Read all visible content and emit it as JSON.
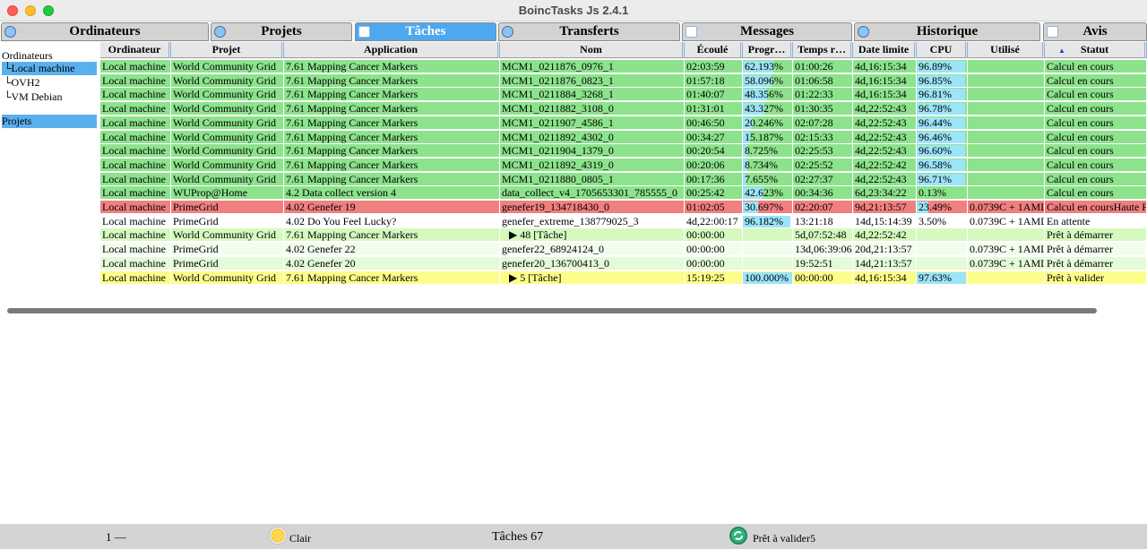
{
  "window": {
    "title": "BoincTasks Js 2.4.1"
  },
  "tabs": [
    {
      "label": "Ordinateurs",
      "icon": "globe-icon",
      "active": false
    },
    {
      "label": "Projets",
      "icon": "link-icon",
      "active": false
    },
    {
      "label": "Tâches",
      "icon": "document-icon",
      "active": true
    },
    {
      "label": "Transferts",
      "icon": "transfer-icon",
      "active": false
    },
    {
      "label": "Messages",
      "icon": "message-icon",
      "active": false
    },
    {
      "label": "Historique",
      "icon": "history-icon",
      "active": false
    },
    {
      "label": "Avis",
      "icon": "notice-icon",
      "active": false
    }
  ],
  "sidebar": {
    "computers_header": "Ordinateurs",
    "computers": [
      {
        "label": "└Local machine",
        "selected": true
      },
      {
        "label": "└OVH2",
        "selected": false
      },
      {
        "label": "└VM Debian",
        "selected": false
      }
    ],
    "projects_header": "Projets"
  },
  "table": {
    "columns": [
      "Ordinateur",
      "Projet",
      "Application",
      "Nom",
      "Écoulé",
      "Progr…",
      "Temps r…",
      "Date limite",
      "CPU",
      "Utilisé",
      "Statut"
    ],
    "rows": [
      {
        "computer": "Local machine",
        "project": "World Community Grid",
        "application": "7.61 Mapping Cancer Markers",
        "name": "MCM1_0211876_0976_1",
        "elapsed": "02:03:59",
        "progress": "62.193%",
        "progress_value": 62.193,
        "remaining": "01:00:26",
        "deadline": "4d,16:15:34",
        "cpu": "96.89%",
        "cpu_value": 96.89,
        "used": "",
        "status": "Calcul en cours",
        "row_color": "#8ce38c",
        "cell_color": "#8ce38c"
      },
      {
        "computer": "Local machine",
        "project": "World Community Grid",
        "application": "7.61 Mapping Cancer Markers",
        "name": "MCM1_0211876_0823_1",
        "elapsed": "01:57:18",
        "progress": "58.096%",
        "progress_value": 58.096,
        "remaining": "01:06:58",
        "deadline": "4d,16:15:34",
        "cpu": "96.85%",
        "cpu_value": 96.85,
        "used": "",
        "status": "Calcul en cours",
        "row_color": "#8ce38c",
        "cell_color": "#8ce38c"
      },
      {
        "computer": "Local machine",
        "project": "World Community Grid",
        "application": "7.61 Mapping Cancer Markers",
        "name": "MCM1_0211884_3268_1",
        "elapsed": "01:40:07",
        "progress": "48.356%",
        "progress_value": 48.356,
        "remaining": "01:22:33",
        "deadline": "4d,16:15:34",
        "cpu": "96.81%",
        "cpu_value": 96.81,
        "used": "",
        "status": "Calcul en cours",
        "row_color": "#8ce38c",
        "cell_color": "#8ce38c"
      },
      {
        "computer": "Local machine",
        "project": "World Community Grid",
        "application": "7.61 Mapping Cancer Markers",
        "name": "MCM1_0211882_3108_0",
        "elapsed": "01:31:01",
        "progress": "43.327%",
        "progress_value": 43.327,
        "remaining": "01:30:35",
        "deadline": "4d,22:52:43",
        "cpu": "96.78%",
        "cpu_value": 96.78,
        "used": "",
        "status": "Calcul en cours",
        "row_color": "#8ce38c",
        "cell_color": "#8ce38c"
      },
      {
        "computer": "Local machine",
        "project": "World Community Grid",
        "application": "7.61 Mapping Cancer Markers",
        "name": "MCM1_0211907_4586_1",
        "elapsed": "00:46:50",
        "progress": "20.246%",
        "progress_value": 20.246,
        "remaining": "02:07:28",
        "deadline": "4d,22:52:43",
        "cpu": "96.44%",
        "cpu_value": 96.44,
        "used": "",
        "status": "Calcul en cours",
        "row_color": "#8ce38c",
        "cell_color": "#8ce38c"
      },
      {
        "computer": "Local machine",
        "project": "World Community Grid",
        "application": "7.61 Mapping Cancer Markers",
        "name": "MCM1_0211892_4302_0",
        "elapsed": "00:34:27",
        "progress": "15.187%",
        "progress_value": 15.187,
        "remaining": "02:15:33",
        "deadline": "4d,22:52:43",
        "cpu": "96.46%",
        "cpu_value": 96.46,
        "used": "",
        "status": "Calcul en cours",
        "row_color": "#8ce38c",
        "cell_color": "#8ce38c"
      },
      {
        "computer": "Local machine",
        "project": "World Community Grid",
        "application": "7.61 Mapping Cancer Markers",
        "name": "MCM1_0211904_1379_0",
        "elapsed": "00:20:54",
        "progress": "8.725%",
        "progress_value": 8.725,
        "remaining": "02:25:53",
        "deadline": "4d,22:52:43",
        "cpu": "96.60%",
        "cpu_value": 96.6,
        "used": "",
        "status": "Calcul en cours",
        "row_color": "#8ce38c",
        "cell_color": "#8ce38c"
      },
      {
        "computer": "Local machine",
        "project": "World Community Grid",
        "application": "7.61 Mapping Cancer Markers",
        "name": "MCM1_0211892_4319_0",
        "elapsed": "00:20:06",
        "progress": "8.734%",
        "progress_value": 8.734,
        "remaining": "02:25:52",
        "deadline": "4d,22:52:42",
        "cpu": "96.58%",
        "cpu_value": 96.58,
        "used": "",
        "status": "Calcul en cours",
        "row_color": "#8ce38c",
        "cell_color": "#8ce38c"
      },
      {
        "computer": "Local machine",
        "project": "World Community Grid",
        "application": "7.61 Mapping Cancer Markers",
        "name": "MCM1_0211880_0805_1",
        "elapsed": "00:17:36",
        "progress": "7.655%",
        "progress_value": 7.655,
        "remaining": "02:27:37",
        "deadline": "4d,22:52:43",
        "cpu": "96.71%",
        "cpu_value": 96.71,
        "used": "",
        "status": "Calcul en cours",
        "row_color": "#8ce38c",
        "cell_color": "#8ce38c"
      },
      {
        "computer": "Local machine",
        "project": "WUProp@Home",
        "application": "4.2 Data collect version 4",
        "name": "data_collect_v4_1705653301_785555_0",
        "elapsed": "00:25:42",
        "progress": "42.623%",
        "progress_value": 42.623,
        "remaining": "00:34:36",
        "deadline": "6d,23:34:22",
        "cpu": "0.13%",
        "cpu_value": 0,
        "used": "",
        "status": "Calcul en cours",
        "row_color": "#8ce38c",
        "cell_color": "#8ce38c"
      },
      {
        "computer": "Local machine",
        "project": "PrimeGrid",
        "application": "4.02 Genefer 19",
        "name": "genefer19_134718430_0",
        "elapsed": "01:02:05",
        "progress": "30.697%",
        "progress_value": 30.697,
        "remaining": "02:20:07",
        "deadline": "9d,21:13:57",
        "cpu": "23.49%",
        "cpu_value": 23.49,
        "used": "0.0739C + 1AMD",
        "status": "Calcul en coursHaute Pr",
        "row_color": "#f08080",
        "cell_color": "#f08080"
      },
      {
        "computer": "Local machine",
        "project": "PrimeGrid",
        "application": "4.02 Do You Feel Lucky?",
        "name": "genefer_extreme_138779025_3",
        "elapsed": "4d,22:00:17",
        "progress": "96.182%",
        "progress_value": 96.182,
        "remaining": "13:21:18",
        "deadline": "14d,15:14:39",
        "cpu": "3.50%",
        "cpu_value": 0,
        "used": "0.0739C + 1AMD",
        "status": "En attente",
        "row_color": "#ffffff",
        "cell_color": "#ffffff"
      },
      {
        "computer": "Local machine",
        "project": "World Community Grid",
        "application": "7.61 Mapping Cancer Markers",
        "name": "▶ 48 [Tâche]",
        "elapsed": "00:00:00",
        "progress": "",
        "progress_value": 0,
        "remaining": "5d,07:52:48",
        "deadline": "4d,22:52:42",
        "cpu": "",
        "cpu_value": 0,
        "used": "",
        "status": "Prêt à démarrer",
        "row_color": "#d6f9c0",
        "cell_color": "#d6f9c0",
        "group": true
      },
      {
        "computer": "Local machine",
        "project": "PrimeGrid",
        "application": "4.02 Genefer 22",
        "name": "genefer22_68924124_0",
        "elapsed": "00:00:00",
        "progress": "",
        "progress_value": 0,
        "remaining": "13d,06:39:06",
        "deadline": "20d,21:13:57",
        "cpu": "",
        "cpu_value": 0,
        "used": "0.0739C + 1AMD",
        "status": "Prêt à démarrer",
        "row_color": "#f3fdee",
        "cell_color": "#f3fdee"
      },
      {
        "computer": "Local machine",
        "project": "PrimeGrid",
        "application": "4.02 Genefer 20",
        "name": "genefer20_136700413_0",
        "elapsed": "00:00:00",
        "progress": "",
        "progress_value": 0,
        "remaining": "19:52:51",
        "deadline": "14d,21:13:57",
        "cpu": "",
        "cpu_value": 0,
        "used": "0.0739C + 1AMD",
        "status": "Prêt à démarrer",
        "row_color": "#e4fad8",
        "cell_color": "#e4fad8"
      },
      {
        "computer": "Local machine",
        "project": "World Community Grid",
        "application": "7.61 Mapping Cancer Markers",
        "name": "▶ 5 [Tâche]",
        "elapsed": "15:19:25",
        "progress": "100.000%",
        "progress_value": 100,
        "remaining": "00:00:00",
        "deadline": "4d,16:15:34",
        "cpu": "97.63%",
        "cpu_value": 97.63,
        "used": "",
        "status": "Prêt à valider",
        "row_color": "#fdfd8a",
        "cell_color": "#fdfd8a",
        "group": true
      }
    ]
  },
  "statusbar": {
    "page": "1 —",
    "theme_label": "Clair",
    "theme_icon": "sun-icon",
    "task_count": "Tâches 67",
    "validate_label": "Prêt à valider5",
    "validate_icon": "refresh-icon"
  },
  "colors": {
    "tab_active": "#4da8f0",
    "tab_inactive": "#d3d3d3",
    "progress_fill": "#9ce4f7",
    "running": "#8ce38c",
    "high_priority": "#f08080",
    "ready_to_report": "#fdfd8a"
  }
}
